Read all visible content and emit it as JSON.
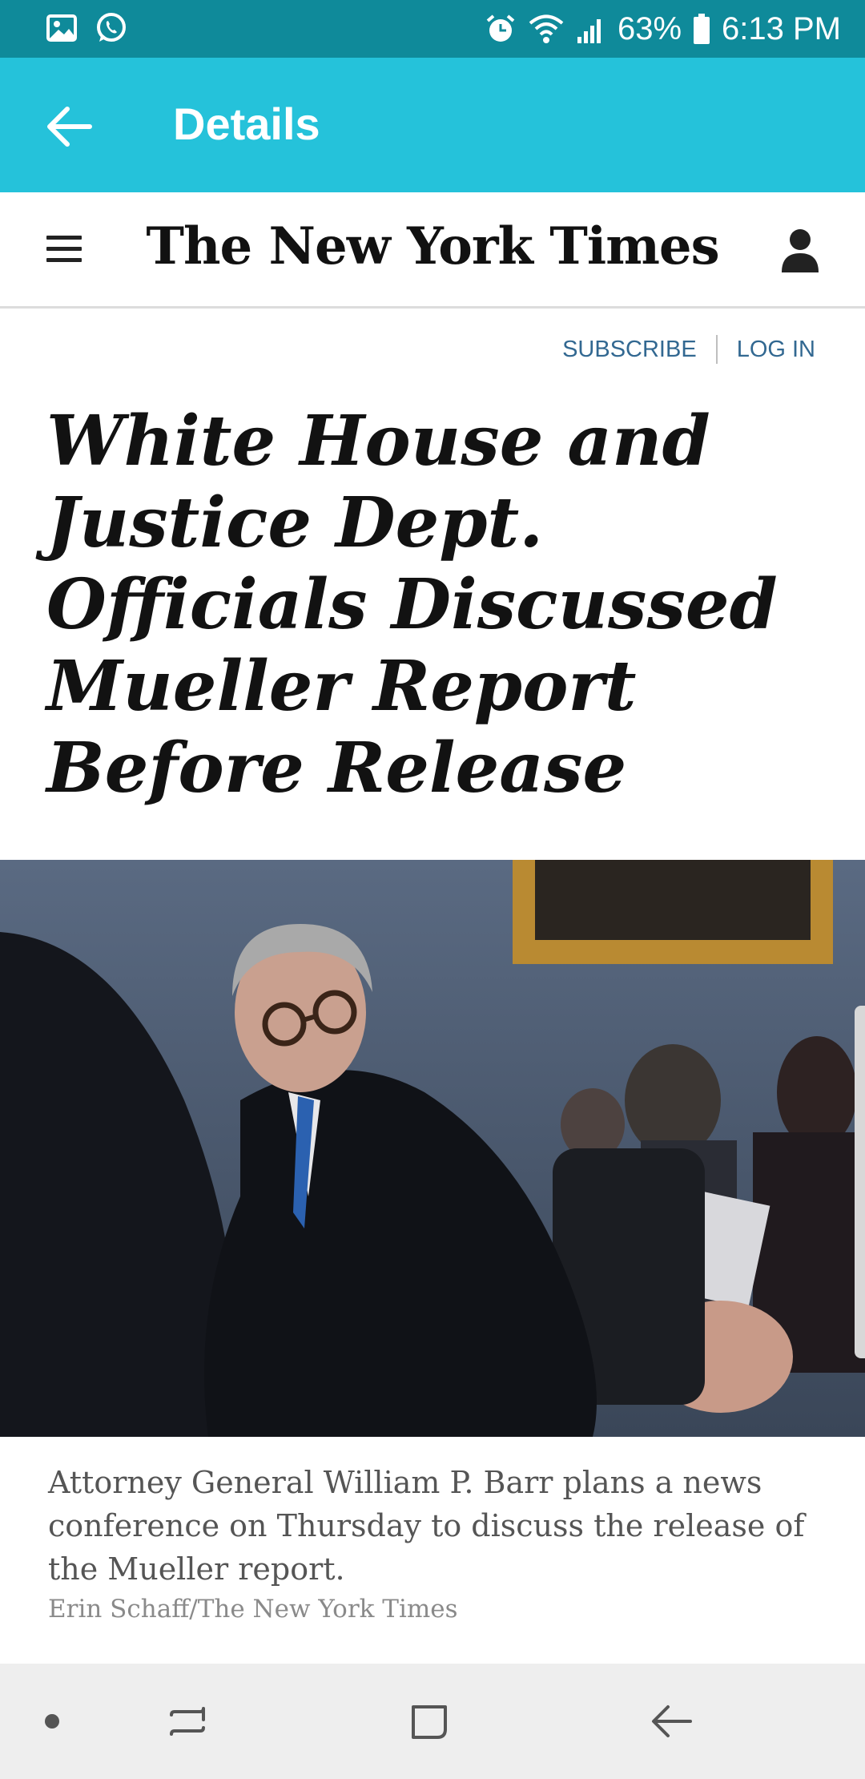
{
  "status_bar": {
    "battery": "63%",
    "time": "6:13 PM",
    "icons": [
      "image-icon",
      "whatsapp-icon",
      "alarm-icon",
      "wifi-icon",
      "signal-icon",
      "battery-icon"
    ]
  },
  "app_bar": {
    "title": "Details"
  },
  "site": {
    "logo": "The New York Times"
  },
  "links": {
    "subscribe": "SUBSCRIBE",
    "login": "LOG IN"
  },
  "article": {
    "headline": "White House and Justice Dept. Officials Discussed Mueller Report Before Release",
    "caption": "Attorney General William P. Barr plans a news conference on Thursday to discuss the release of the Mueller report.",
    "credit": "Erin Schaff/The New York Times"
  },
  "colors": {
    "status_bar": "#0f8a9a",
    "app_bar": "#25c2da",
    "link": "#326891"
  }
}
